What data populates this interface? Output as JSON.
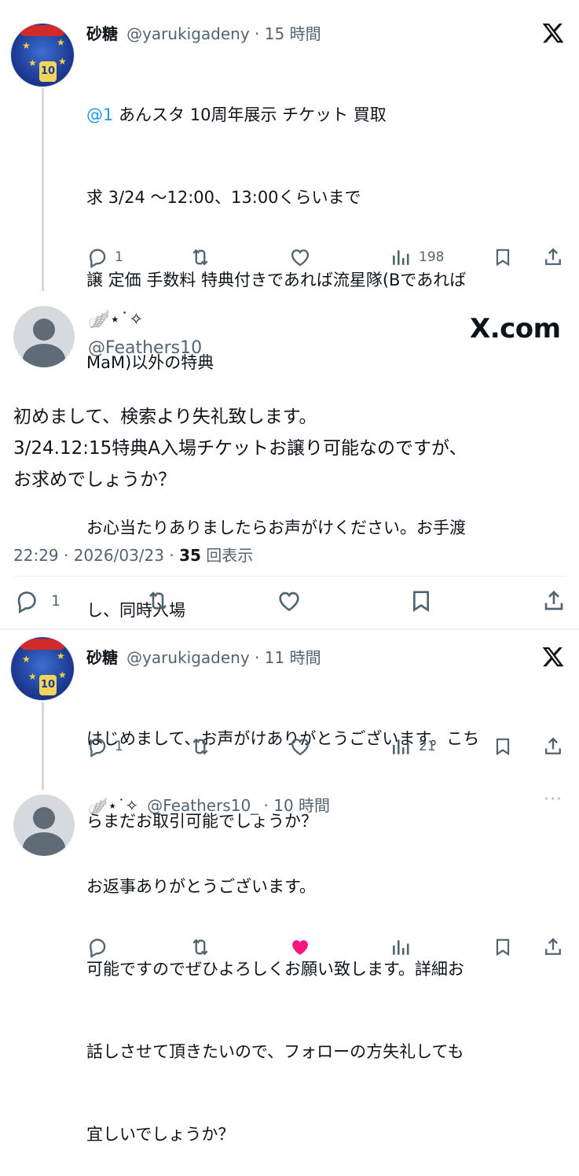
{
  "tweet1": {
    "name": "砂糖",
    "handle_time": "@yarukigadeny · 15 時間",
    "mention": "@1",
    "line1": " あんスタ 10周年展示 チケット 買取",
    "line2": "求 3/24 〜12:00、13:00くらいまで",
    "line3": "譲 定価 手数料 特典付きであれば流星隊(Bであれば",
    "line4": "MaM)以外の特典",
    "line5": "お心当たりありましたらお声がけください。お手渡",
    "line6": "し、同時入場",
    "reply_count": "1",
    "views": "198"
  },
  "reply_main": {
    "display_name": "🪽⋆˙✧",
    "handle": "@Feathers10_",
    "brand": "X.com",
    "text_line1": "初めまして、検索より失礼致します。",
    "text_line2": "3/24.12:15特典A入場チケットお譲り可能なのですが、",
    "text_line3": "お求めでしょうか？",
    "timestamp": "22:29 · 2026/03/23 · ",
    "view_count": "35",
    "view_label": " 回表示",
    "reply_count": "1"
  },
  "tweet3": {
    "name": "砂糖",
    "handle_time": "@yarukigadeny · 11 時間",
    "line1": "はじめまして、お声がけありがとうございます。こち",
    "line2": "らまだお取引可能でしょうか？",
    "reply_count": "1",
    "views": "21"
  },
  "tweet4": {
    "display_name": "🪽⋆˙✧",
    "handle_time": "@Feathers10_ · 10 時間",
    "more": "···",
    "line1": "お返事ありがとうございます。",
    "line2": "可能ですのでぜひよろしくお願い致します。詳細お",
    "line3": "話しさせて頂きたいので、フォローの方失礼しても",
    "line4": "宜しいでしょうか？"
  },
  "colors": {
    "text": "#0f1419",
    "secondary": "#536471",
    "accent": "#1d9bf0",
    "like_active": "#f91880",
    "thread_line": "#cfd9de"
  },
  "icons": [
    "reply-icon",
    "retweet-icon",
    "like-icon",
    "views-icon",
    "bookmark-icon",
    "share-icon",
    "x-logo-icon",
    "more-icon"
  ]
}
